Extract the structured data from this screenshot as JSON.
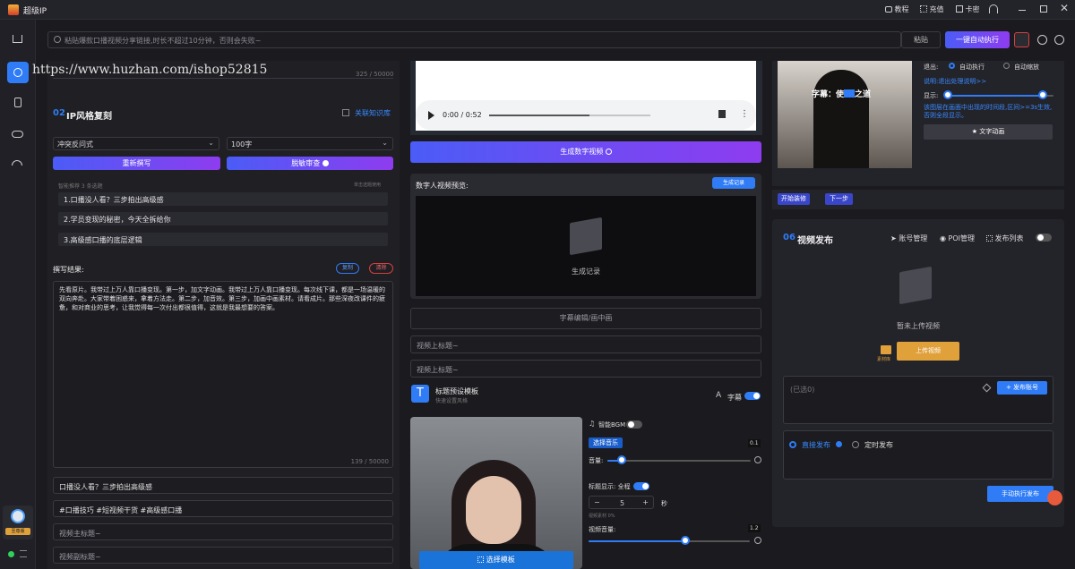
{
  "app": {
    "title": "超级IP"
  },
  "titlebar": {
    "tutorial": "教程",
    "recharge": "充值",
    "card": "卡密"
  },
  "top": {
    "input_placeholder": "粘贴爆款口播视频分享链接,时长不超过10分钟，否则会失败~",
    "paste_label": "粘贴",
    "run_label": "一键自动执行"
  },
  "watermark": "https://www.huzhan.com/ishop52815",
  "left": {
    "top_counter": "325 / 50000",
    "section_num": "02",
    "section_title": "IP风格复刻",
    "kb_label": "关联知识库",
    "select1": "冲突反问式",
    "select2": "100字",
    "rewrite_label": "重新撰写",
    "sensitive_label": "脱敏审查",
    "recommend_header": "智能推荐 3 条选题",
    "recommend_hint": "单击选题使用",
    "topics": [
      "1.口播没人看？三步拍出高级感",
      "2.学员变现的秘密，今天全拆给你",
      "3.高级感口播的底层逻辑"
    ],
    "result_label": "撰写结果:",
    "copy_label": "复制",
    "clear_label": "清除",
    "result_text": "先看原片。我带过上万人靠口播变现。第一步，加文字动画。我带过上万人靠口播变现。每次线下课，都是一场温暖的双向奔赴。大家带着困惑来，拿着方法走。第二步，加音效。第三步，加画中画素材。请看成片。那些深夜改课件的疲惫，和对商业的思考，让我觉得每一次付出都很值得，这就是我最想要的答案。",
    "result_counter": "139 / 50000",
    "fields": [
      "口播没人看？三步拍出高级感",
      "#口播技巧 #短视频干货 #高级感口播"
    ],
    "placeholders": [
      "视频主标题~",
      "视频副标题~"
    ],
    "user_badge": "至尊版"
  },
  "mid": {
    "audio_time": "0:00 / 0:52",
    "audio_progress": 0.62,
    "gen_digital_label": "生成数字视频",
    "preview_label": "数字人视频预览:",
    "gen_record_btn": "生成记录",
    "empty_label": "生成记录",
    "subtitle_edit": "字幕编辑/画中画",
    "placeholder_top": "视频上标题~",
    "placeholder_top2": "视频上标题~",
    "template_title": "标题预设模板",
    "template_sub": "快速设置风格",
    "subtitle_label": "字幕",
    "smart_bgm": "智能BGM",
    "choose_music": "选择音乐",
    "volume_label": "音量:",
    "volume_value": "0.1",
    "volume_fraction": 0.1,
    "title_display": "标题显示: 全程",
    "stepper_value": "5",
    "seconds_label": "秒",
    "material_hint": "视频素材 0%",
    "video_volume_label": "视频音量:",
    "video_volume_value": "1.2",
    "video_volume_fraction": 0.6,
    "choose_template": "选择模板"
  },
  "right": {
    "caption_a": "字幕：使",
    "caption_b": "之道",
    "exit_label": "退出:",
    "auto_exec": "自动执行",
    "auto_zoom": "自动缩放",
    "exit_help": "说明:退出处理说明>>",
    "display_label": "显示:",
    "display_fraction": 0.9,
    "layer_note": "该图层在画面中出现的时间段,区间>=3s生效,否则全段显示。",
    "text_anim": "文字动画",
    "start_edit": "开始装修",
    "next_step": "下一步",
    "section_num": "06",
    "section_title": "视频发布",
    "account_mgmt": "账号管理",
    "poi_mgmt": "POI管理",
    "publish_list": "发布列表",
    "not_uploaded": "暂未上传视频",
    "material_lib": "素材库",
    "upload_video": "上传视频",
    "selected": "(已选0)",
    "publish_account": "发布账号",
    "direct_publish": "直接发布",
    "timed_publish": "定时发布",
    "manual_publish": "手动执行发布"
  },
  "colors": {
    "accent": "#2f7cf6",
    "grad_start": "#4b5cf6",
    "grad_end": "#8e3cf0",
    "orange": "#e0a03a",
    "red": "#d84040"
  }
}
